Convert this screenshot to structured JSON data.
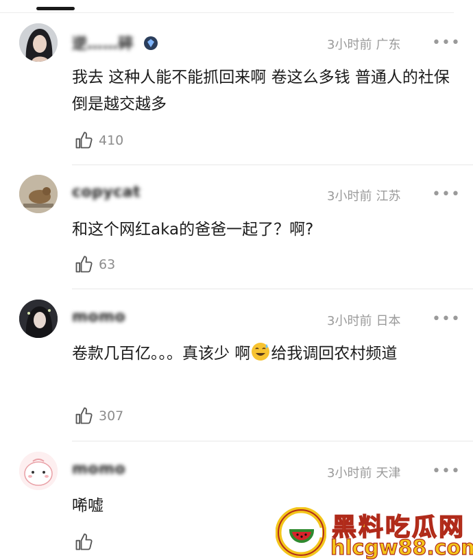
{
  "comments": [
    {
      "user": "逆……碎",
      "time": "3小时前",
      "location": "广东",
      "text": "我去 这种人能不能抓回来啊 卷这么多钱 普通人的社保倒是越交越多",
      "likes": "410"
    },
    {
      "user": "copycat",
      "time": "3小时前",
      "location": "江苏",
      "text": "和这个网红aka的爸爸一起了？啊?",
      "likes": "63"
    },
    {
      "user": "momo",
      "time": "3小时前",
      "location": "日本",
      "text_before_emoji": "卷款几百亿。。。真该少 啊",
      "text_after_emoji": "给我调回农村频道",
      "likes": "307"
    },
    {
      "user": "momo",
      "time": "3小时前",
      "location": "天津",
      "text": "唏嘘",
      "likes": ""
    }
  ],
  "more_label": "•••",
  "watermark": {
    "title": "黑料吃瓜网",
    "url": "hlcgw88.com"
  },
  "icons": {
    "like": "thumbs-up-icon",
    "more": "more-dots-icon",
    "badge": "diamond-badge-icon",
    "emoji": "sweat-smile-emoji"
  }
}
